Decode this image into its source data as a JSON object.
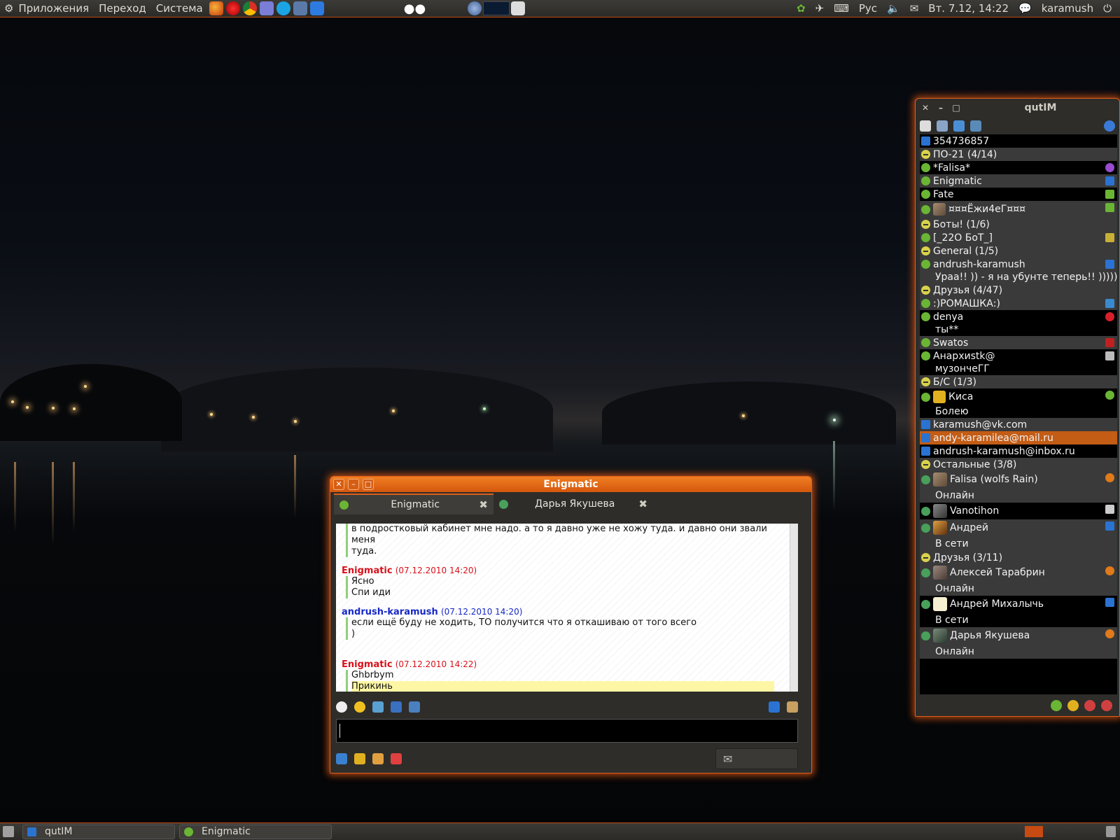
{
  "top_panel": {
    "menus": [
      "Приложения",
      "Переход",
      "Система"
    ],
    "keyboard_layout": "Рус",
    "clock": "Вт. 7.12, 14:22",
    "user": "karamush"
  },
  "qutim": {
    "title": "qutIM",
    "roster": [
      {
        "kind": "account",
        "label": "354736857"
      },
      {
        "kind": "group",
        "label": "ПО-21 (4/14)"
      },
      {
        "kind": "contact",
        "label": "*Falisa*"
      },
      {
        "kind": "contact",
        "label": "Enigmatic"
      },
      {
        "kind": "contact",
        "label": "Fate"
      },
      {
        "kind": "contact",
        "label": "¤¤¤Ёжи4еГ¤¤¤"
      },
      {
        "kind": "group",
        "label": "Боты! (1/6)"
      },
      {
        "kind": "contact",
        "label": "[_22O БоТ_]"
      },
      {
        "kind": "group",
        "label": "General (1/5)"
      },
      {
        "kind": "contact",
        "label": "andrush-karamush",
        "status": "Ураа!! )) - я на убунте теперь!! )))))) с"
      },
      {
        "kind": "group",
        "label": "Друзья (4/47)"
      },
      {
        "kind": "contact",
        "label": ":)РОМАШКА:)"
      },
      {
        "kind": "contact",
        "label": "denya",
        "status": "ты**"
      },
      {
        "kind": "contact",
        "label": "Swatos"
      },
      {
        "kind": "contact",
        "label": "Анархиstk@",
        "status": "музончеГГ"
      },
      {
        "kind": "group",
        "label": "Б/С (1/3)"
      },
      {
        "kind": "contact",
        "label": "Киса",
        "status": "Болею"
      },
      {
        "kind": "account",
        "label": "karamush@vk.com"
      },
      {
        "kind": "account",
        "label": "andy-karamilea@mail.ru"
      },
      {
        "kind": "account",
        "label": "andrush-karamush@inbox.ru"
      },
      {
        "kind": "group",
        "label": "Остальные (3/8)"
      },
      {
        "kind": "contact",
        "label": "Falisa (wolfs Rain)",
        "status": "Онлайн"
      },
      {
        "kind": "contact",
        "label": "Vanotihon"
      },
      {
        "kind": "contact",
        "label": "Андрей",
        "status": "В сети"
      },
      {
        "kind": "group",
        "label": "Друзья (3/11)"
      },
      {
        "kind": "contact",
        "label": "Алексей Тарабрин",
        "status": "Онлайн"
      },
      {
        "kind": "contact",
        "label": "Андрей Михалычь",
        "status": "В сети"
      },
      {
        "kind": "contact",
        "label": "Дарья Якушева",
        "status": "Онлайн"
      }
    ]
  },
  "chat": {
    "title": "Enigmatic",
    "tabs": [
      {
        "label": "Enigmatic"
      },
      {
        "label": "Дарья Якушева"
      }
    ],
    "messages": [
      {
        "lines": [
          "в подростковый кабинет мне надо. а то я давно уже не хожу туда. и давно они звали меня",
          "туда."
        ]
      },
      {
        "sender": "Enigmatic",
        "time": "(07.12.2010 14:20)",
        "lines": [
          "Ясно",
          "Спи иди"
        ]
      },
      {
        "sender": "andrush-karamush",
        "time": "(07.12.2010 14:20)",
        "lines": [
          "если ещё буду не ходить, ТО получится что я откашиваю от того всего",
          ")"
        ]
      },
      {
        "sender": "Enigmatic",
        "time": "(07.12.2010 14:22)",
        "lines": [
          "Ghbrbym",
          "Прикинь"
        ]
      }
    ]
  },
  "taskbar": {
    "items": [
      {
        "label": "qutIM"
      },
      {
        "label": "Enigmatic"
      }
    ]
  }
}
